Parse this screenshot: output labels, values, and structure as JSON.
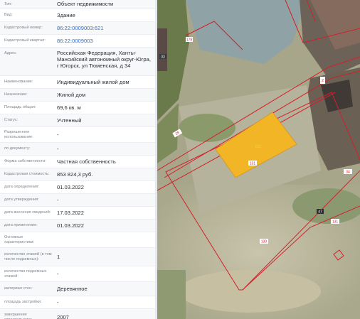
{
  "panel": {
    "rows": [
      {
        "label": "Тип:",
        "value": "Объект недвижимости"
      },
      {
        "label": "Вид:",
        "value": "Здание"
      },
      {
        "label": "Кадастровый номер:",
        "value": "86:22:0009003:621",
        "link": true
      },
      {
        "label": "Кадастровый квартал:",
        "value": "86:22:0009003",
        "link": true
      },
      {
        "label": "Адрес:",
        "value": "Российская Федерация, Ханты-Мансийский автономный округ-Югра, г Югорск, ул Тюменская, д 34"
      },
      {
        "label": "Наименование:",
        "value": "Индивидуальный жилой дом"
      },
      {
        "label": "Назначение:",
        "value": "Жилой дом"
      },
      {
        "label": "Площадь общая:",
        "value": "69,6 кв. м"
      },
      {
        "label": "Статус:",
        "value": "Учтенный"
      },
      {
        "label": "Разрешенное использование:",
        "value": "-"
      },
      {
        "label": "по документу:",
        "value": "-"
      },
      {
        "label": "Форма собственности:",
        "value": "Частная собственность"
      },
      {
        "label": "Кадастровая стоимость:",
        "value": "853 824,3 руб."
      },
      {
        "label": "дата определения:",
        "value": "01.03.2022"
      },
      {
        "label": "дата утверждения:",
        "value": "-"
      },
      {
        "label": "дата внесения сведений:",
        "value": "17.03.2022"
      },
      {
        "label": "дата применения:",
        "value": "01.03.2022"
      },
      {
        "label": "Основные характеристики:",
        "value": ""
      },
      {
        "label": "количество этажей (в том числе подземных):",
        "value": "1"
      },
      {
        "label": "количество подземных этажей:",
        "value": "-"
      },
      {
        "label": "материал стен:",
        "value": "Деревянное"
      },
      {
        "label": "площадь застройки:",
        "value": "-"
      },
      {
        "label": "завершение строительства:",
        "value": "2007"
      }
    ]
  },
  "map": {
    "parcel_labels": [
      "178",
      "33",
      "2",
      "29",
      "621",
      "131",
      "34",
      "47",
      "131",
      "130",
      "11",
      "2"
    ],
    "colors": {
      "building_fill": "#f2b526",
      "boundary": "#d41f2a",
      "label_bg": "#ffffff"
    }
  }
}
